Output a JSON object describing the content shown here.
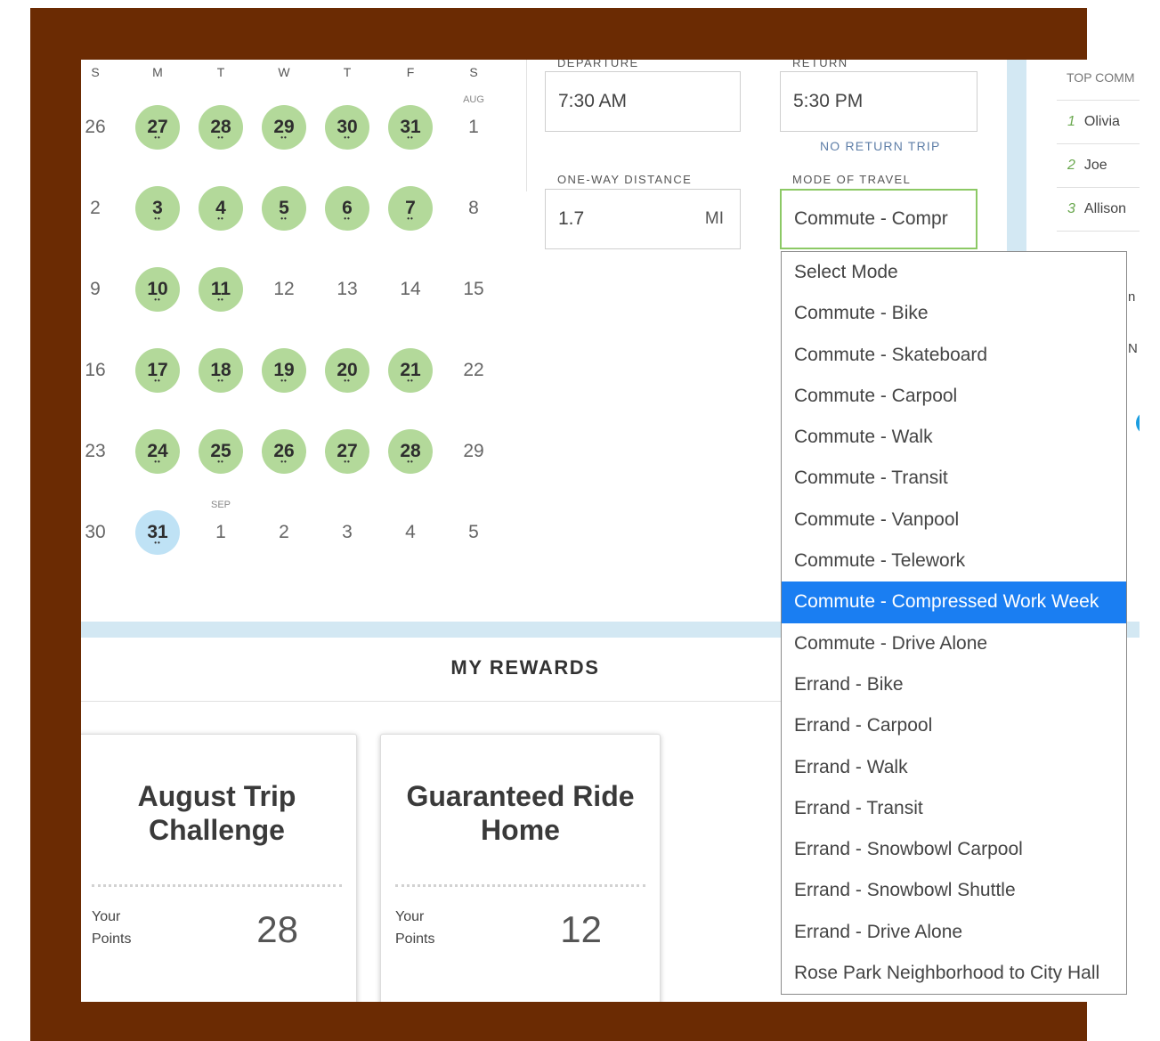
{
  "calendar": {
    "dow": [
      "S",
      "M",
      "T",
      "W",
      "T",
      "F",
      "S"
    ],
    "weeks": [
      [
        {
          "d": "26"
        },
        {
          "d": "27",
          "hl": true
        },
        {
          "d": "28",
          "hl": true
        },
        {
          "d": "29",
          "hl": true
        },
        {
          "d": "30",
          "hl": true
        },
        {
          "d": "31",
          "hl": true
        },
        {
          "d": "1",
          "mon": "AUG"
        }
      ],
      [
        {
          "d": "2"
        },
        {
          "d": "3",
          "hl": true
        },
        {
          "d": "4",
          "hl": true
        },
        {
          "d": "5",
          "hl": true
        },
        {
          "d": "6",
          "hl": true
        },
        {
          "d": "7",
          "hl": true
        },
        {
          "d": "8"
        }
      ],
      [
        {
          "d": "9"
        },
        {
          "d": "10",
          "hl": true
        },
        {
          "d": "11",
          "hl": true
        },
        {
          "d": "12"
        },
        {
          "d": "13"
        },
        {
          "d": "14"
        },
        {
          "d": "15"
        }
      ],
      [
        {
          "d": "16"
        },
        {
          "d": "17",
          "hl": true
        },
        {
          "d": "18",
          "hl": true
        },
        {
          "d": "19",
          "hl": true
        },
        {
          "d": "20",
          "hl": true
        },
        {
          "d": "21",
          "hl": true
        },
        {
          "d": "22"
        }
      ],
      [
        {
          "d": "23"
        },
        {
          "d": "24",
          "hl": true
        },
        {
          "d": "25",
          "hl": true
        },
        {
          "d": "26",
          "hl": true
        },
        {
          "d": "27",
          "hl": true
        },
        {
          "d": "28",
          "hl": true
        },
        {
          "d": "29"
        }
      ],
      [
        {
          "d": "30"
        },
        {
          "d": "31",
          "today": true
        },
        {
          "d": "1",
          "mon": "SEP"
        },
        {
          "d": "2"
        },
        {
          "d": "3"
        },
        {
          "d": "4"
        },
        {
          "d": "5"
        }
      ]
    ]
  },
  "trip": {
    "departure_label": "DEPARTURE",
    "departure_value": "7:30 AM",
    "return_label": "RETURN",
    "return_value": "5:30 PM",
    "no_return_link": "NO RETURN TRIP",
    "distance_label": "ONE-WAY DISTANCE",
    "distance_value": "1.7",
    "distance_unit": "MI",
    "mode_label": "MODE OF TRAVEL",
    "mode_value": "Commute - Compr"
  },
  "leaderboard": {
    "title": "TOP COMM",
    "rows": [
      {
        "rank": "1",
        "name": "Olivia"
      },
      {
        "rank": "2",
        "name": "Joe"
      },
      {
        "rank": "3",
        "name": "Allison"
      }
    ],
    "partial_1": "n",
    "partial_2": "N"
  },
  "rewards": {
    "title": "MY REWARDS",
    "cards": [
      {
        "title_1": "August Trip",
        "title_2": "Challenge",
        "label_1": "Your",
        "label_2": "Points",
        "points": "28"
      },
      {
        "title_1": "Guaranteed Ride",
        "title_2": "Home",
        "label_1": "Your",
        "label_2": "Points",
        "points": "12"
      }
    ]
  },
  "mode_options": [
    {
      "label": "Select Mode"
    },
    {
      "label": "Commute - Bike"
    },
    {
      "label": "Commute - Skateboard"
    },
    {
      "label": "Commute - Carpool"
    },
    {
      "label": "Commute - Walk"
    },
    {
      "label": "Commute - Transit"
    },
    {
      "label": "Commute - Vanpool"
    },
    {
      "label": "Commute - Telework"
    },
    {
      "label": "Commute - Compressed Work Week",
      "selected": true
    },
    {
      "label": "Commute - Drive Alone"
    },
    {
      "label": "Errand - Bike"
    },
    {
      "label": "Errand - Carpool"
    },
    {
      "label": "Errand - Walk"
    },
    {
      "label": "Errand - Transit"
    },
    {
      "label": "Errand - Snowbowl Carpool"
    },
    {
      "label": "Errand - Snowbowl Shuttle"
    },
    {
      "label": "Errand - Drive Alone"
    },
    {
      "label": "Rose Park Neighborhood to City Hall"
    }
  ],
  "colors": {
    "frame": "#6b2b03",
    "logged_day": "#b3d99a",
    "today": "#bfe2f5",
    "selected_option": "#1a7ef2",
    "focus_border": "#8cc965"
  }
}
